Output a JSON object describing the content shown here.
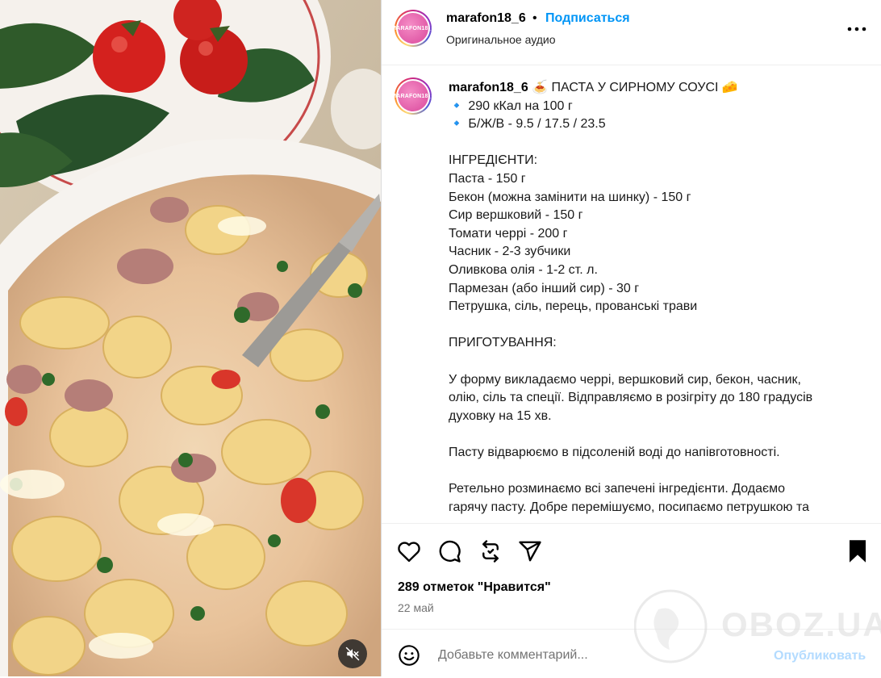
{
  "header": {
    "username": "marafon18_6",
    "separator": "•",
    "follow_label": "Подписаться",
    "audio_label": "Оригинальное аудио",
    "avatar_text": "MARAFON18_6"
  },
  "caption": {
    "username": "marafon18_6",
    "title": " 🍝 ПАСТА У СИРНОМУ СОУСІ 🧀",
    "lines": [
      "🔹 290 кКал на 100 г",
      "🔹 Б/Ж/В - 9.5 / 17.5 / 23.5",
      "",
      "ІНГРЕДІЄНТИ:",
      "Паста - 150 г",
      "Бекон (можна замінити на шинку) - 150 г",
      "Сир вершковий - 150 г",
      "Томати черрі - 200 г",
      "Часник - 2-3 зубчики",
      "Оливкова олія - 1-2 ст. л.",
      "Пармезан (або інший сир) - 30 г",
      "Петрушка, сіль, перець, прованські трави",
      "",
      "ПРИГОТУВАННЯ:",
      "",
      "У форму викладаємо черрі, вершковий сир, бекон, часник,",
      "олію, сіль та спеції. Відправляємо в розігріту до 180 градусів",
      "духовку на 15 хв.",
      "",
      "Пасту відварюємо в підсоленій воді до напівготовності.",
      "",
      "Ретельно розминаємо всі запечені інгредієнти. Додаємо",
      "гарячу пасту. Добре перемішуємо, посипаємо петрушкою та"
    ]
  },
  "actions": {
    "icons": [
      "heart-icon",
      "comment-icon",
      "repost-icon",
      "share-icon",
      "bookmark-icon"
    ],
    "likes_text": "289 отметок \"Нравится\"",
    "date_text": "22 май"
  },
  "comment": {
    "placeholder": "Добавьте комментарий...",
    "publish_label": "Опубликовать"
  },
  "watermark": {
    "text": "OBOZ.UA"
  },
  "colors": {
    "link_blue": "#0095f6",
    "publish_disabled": "#b3dbff",
    "secondary_text": "#737373"
  }
}
